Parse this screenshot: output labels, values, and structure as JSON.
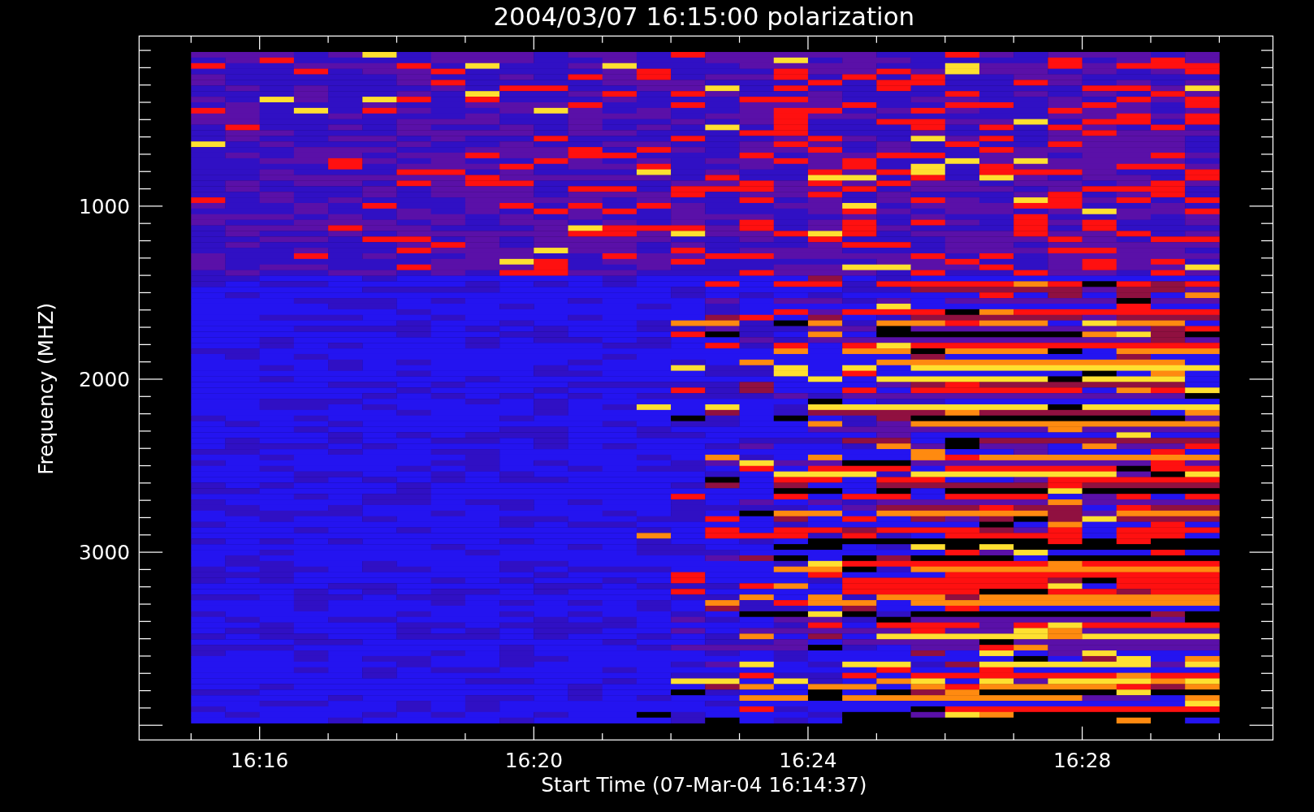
{
  "title": "2004/03/07 16:15:00 polarization",
  "x_axis": {
    "label": "Start Time (07-Mar-04 16:14:37)",
    "ticks": [
      "16:16",
      "16:20",
      "16:24",
      "16:28"
    ]
  },
  "y_axis": {
    "label": "Frequency (MHZ)",
    "ticks": [
      "1000",
      "2000",
      "3000"
    ]
  }
}
